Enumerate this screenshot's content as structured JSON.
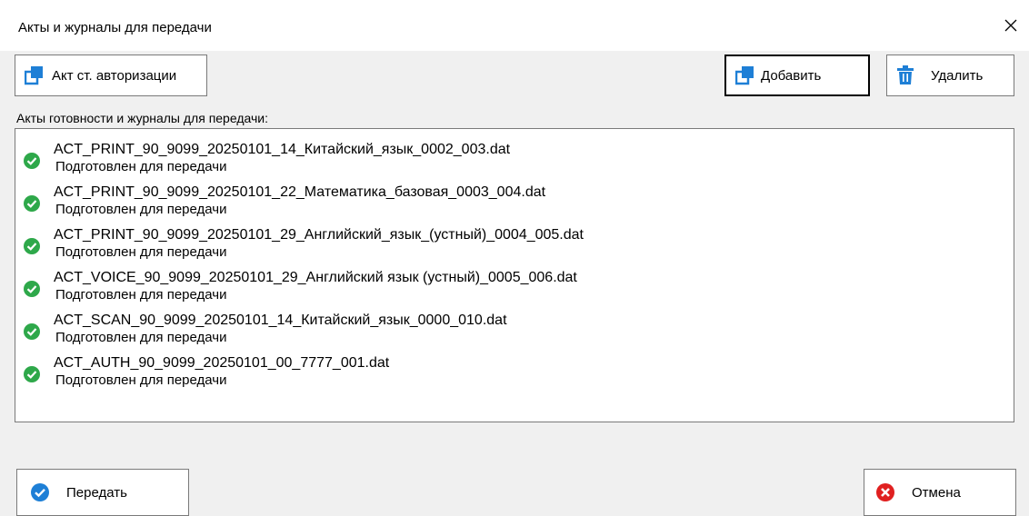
{
  "window": {
    "title": "Акты и журналы для передачи"
  },
  "toolbar": {
    "auth_act_label": "Акт ст. авторизации",
    "add_label": "Добавить",
    "delete_label": "Удалить"
  },
  "list": {
    "label": "Акты готовности и журналы для передачи:",
    "items": [
      {
        "name": "ACT_PRINT_90_9099_20250101_14_Китайский_язык_0002_003.dat",
        "status": "Подготовлен для передачи"
      },
      {
        "name": "ACT_PRINT_90_9099_20250101_22_Математика_базовая_0003_004.dat",
        "status": "Подготовлен для передачи"
      },
      {
        "name": "ACT_PRINT_90_9099_20250101_29_Английский_язык_(устный)_0004_005.dat",
        "status": "Подготовлен для передачи"
      },
      {
        "name": "ACT_VOICE_90_9099_20250101_29_Английский язык (устный)_0005_006.dat",
        "status": "Подготовлен для передачи"
      },
      {
        "name": "ACT_SCAN_90_9099_20250101_14_Китайский_язык_0000_010.dat",
        "status": "Подготовлен для передачи"
      },
      {
        "name": "ACT_AUTH_90_9099_20250101_00_7777_001.dat",
        "status": "Подготовлен для передачи"
      }
    ]
  },
  "footer": {
    "send_label": "Передать",
    "cancel_label": "Отмена"
  },
  "icons": {
    "close": "close-icon",
    "copy": "copy-icon",
    "trash": "trash-icon",
    "check": "check-circle-icon",
    "error": "error-circle-icon"
  },
  "colors": {
    "accent_blue": "#1e7fd6",
    "success_green": "#2ea84a",
    "error_red": "#e02020"
  }
}
